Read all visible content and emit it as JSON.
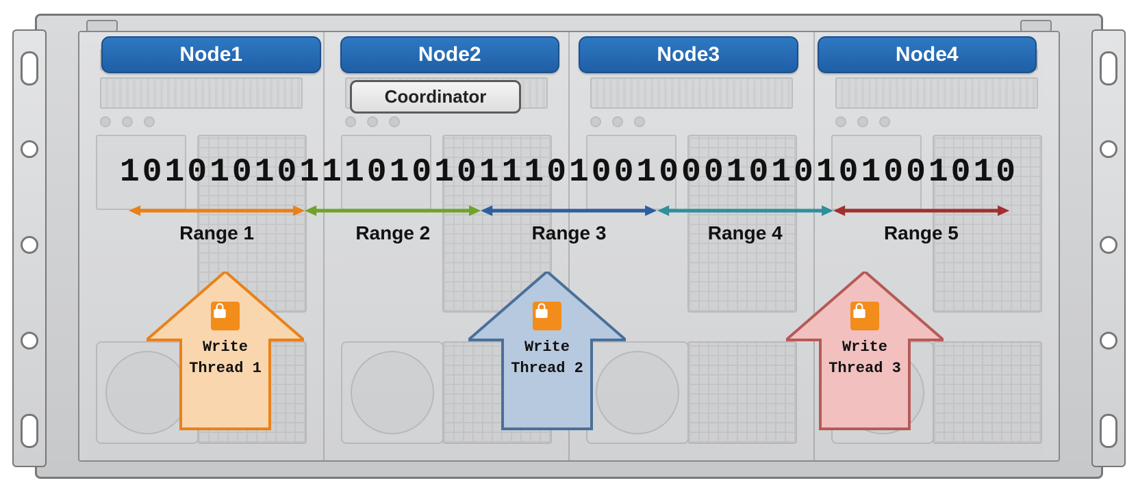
{
  "nodes": [
    "Node1",
    "Node2",
    "Node3",
    "Node4"
  ],
  "coordinator_label": "Coordinator",
  "binary_stream": "1010101011101010111010010001010101001010",
  "ranges": [
    {
      "label": "Range 1",
      "color": "#e8811a"
    },
    {
      "label": "Range 2",
      "color": "#6fa32b"
    },
    {
      "label": "Range 3",
      "color": "#2d5f9e"
    },
    {
      "label": "Range 4",
      "color": "#2f8f9a"
    },
    {
      "label": "Range 5",
      "color": "#a03030"
    }
  ],
  "threads": [
    {
      "write": "Write",
      "label": "Thread 1",
      "fill": "#f9d6ad",
      "stroke": "#e8811a"
    },
    {
      "write": "Write",
      "label": "Thread 2",
      "fill": "#b6c9de",
      "stroke": "#4a6f99"
    },
    {
      "write": "Write",
      "label": "Thread 3",
      "fill": "#f1c0bf",
      "stroke": "#b55a58"
    }
  ],
  "colors": {
    "node_bg": "#2766ad",
    "lock_bg": "#f28c1b"
  }
}
